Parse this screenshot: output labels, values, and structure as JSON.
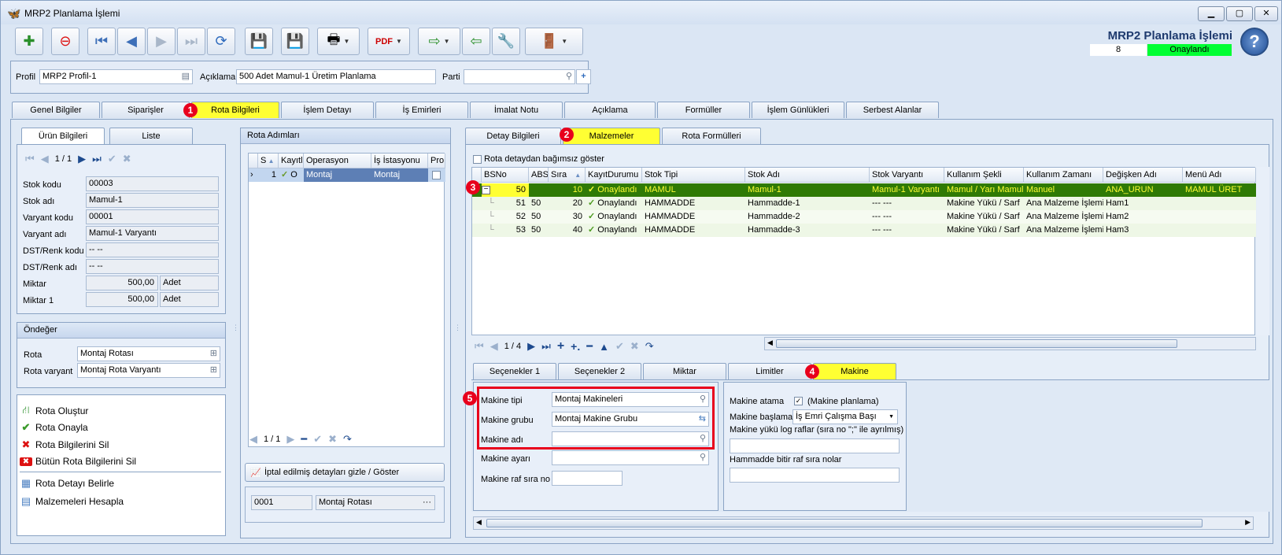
{
  "window": {
    "title": "MRP2 Planlama İşlemi",
    "header_title": "MRP2 Planlama İşlemi",
    "record_no": "8",
    "record_status": "Onaylandı"
  },
  "profile": {
    "profil_label": "Profil",
    "profil_value": "MRP2 Profil-1",
    "aciklama_label": "Açıklama",
    "aciklama_value": "500 Adet Mamul-1 Üretim Planlama",
    "parti_label": "Parti",
    "parti_value": ""
  },
  "main_tabs": [
    "Genel Bilgiler",
    "Siparişler",
    "Rota Bilgileri",
    "İşlem Detayı",
    "İş Emirleri",
    "İmalat Notu",
    "Açıklama",
    "Formüller",
    "İşlem Günlükleri",
    "Serbest Alanlar"
  ],
  "badges": [
    "1",
    "2",
    "3",
    "4",
    "5"
  ],
  "left": {
    "tabs": [
      "Ürün Bilgileri",
      "Liste"
    ],
    "nav_text": "1 / 1",
    "fields": [
      {
        "label": "Stok kodu",
        "value": "00003"
      },
      {
        "label": "Stok adı",
        "value": "Mamul-1"
      },
      {
        "label": "Varyant kodu",
        "value": "00001"
      },
      {
        "label": "Varyant adı",
        "value": "Mamul-1 Varyantı"
      },
      {
        "label": "DST/Renk kodu",
        "value": "-- --"
      },
      {
        "label": "DST/Renk adı",
        "value": "-- --"
      }
    ],
    "miktar_label": "Miktar",
    "miktar_value": "500,00",
    "miktar_unit": "Adet",
    "miktar1_label": "Miktar 1",
    "miktar1_value": "500,00",
    "miktar1_unit": "Adet",
    "ondeger_title": "Öndeğer",
    "rota_label": "Rota",
    "rota_value": "Montaj Rotası",
    "rota_varyant_label": "Rota varyant",
    "rota_varyant_value": "Montaj Rota Varyantı",
    "actions": [
      "Rota Oluştur",
      "Rota Onayla",
      "Rota Bilgilerini Sil",
      "Bütün Rota Bilgilerini Sil",
      "Rota Detayı Belirle",
      "Malzemeleri Hesapla"
    ]
  },
  "middle": {
    "title": "Rota Adımları",
    "headers": [
      "S",
      "Kayıtl",
      "Operasyon",
      "İş İstasyonu",
      "Pro"
    ],
    "row": [
      "1",
      "O",
      "Montaj",
      "Montaj",
      ""
    ],
    "nav_text": "1 / 1",
    "toggle_button": "İptal edilmiş detayları gizle / Göster",
    "bottom_code": "0001",
    "bottom_name": "Montaj Rotası",
    "bottom_dots": "···"
  },
  "right": {
    "tabs": [
      "Detay Bilgileri",
      "Malzemeler",
      "Rota Formülleri"
    ],
    "checkbox_label": "Rota detaydan bağımsız göster",
    "headers": [
      "BSNo",
      "ABS",
      "Sıra",
      "KayıtDurumu",
      "Stok Tipi",
      "Stok Adı",
      "Stok Varyantı",
      "Kullanım Şekli",
      "Kullanım Zamanı",
      "Değişken Adı",
      "Menü Adı"
    ],
    "rows": [
      [
        "50",
        "",
        "10",
        "Onaylandı",
        "MAMUL",
        "Mamul-1",
        "Mamul-1 Varyantı",
        "Mamul / Yarı Mamul",
        "Manuel",
        "ANA_URUN",
        "MAMUL ÜRET"
      ],
      [
        "51",
        "50",
        "20",
        "Onaylandı",
        "HAMMADDE",
        "Hammadde-1",
        "--- ---",
        "Makine Yükü / Sarf",
        "Ana Malzeme İşlemi",
        "Ham1",
        ""
      ],
      [
        "52",
        "50",
        "30",
        "Onaylandı",
        "HAMMADDE",
        "Hammadde-2",
        "--- ---",
        "Makine Yükü / Sarf",
        "Ana Malzeme İşlemi",
        "Ham2",
        ""
      ],
      [
        "53",
        "50",
        "40",
        "Onaylandı",
        "HAMMADDE",
        "Hammadde-3",
        "--- ---",
        "Makine Yükü / Sarf",
        "Ana Malzeme İşlemi",
        "Ham3",
        ""
      ]
    ],
    "nav_text": "1 / 4",
    "sub_tabs": [
      "Seçenekler 1",
      "Seçenekler 2",
      "Miktar",
      "Limitler",
      "Makine"
    ],
    "makine_tipi_label": "Makine tipi",
    "makine_tipi_value": "Montaj Makineleri",
    "makine_grubu_label": "Makine grubu",
    "makine_grubu_value": "Montaj Makine Grubu",
    "makine_adi_label": "Makine adı",
    "makine_adi_value": "",
    "makine_ayari_label": "Makine ayarı",
    "makine_ayari_value": "",
    "makine_raf_label": "Makine raf sıra no",
    "makine_raf_value": "",
    "makine_atama_label": "Makine atama",
    "makine_planlama_label": "(Makine planlama)",
    "makine_baslama_label": "Makine başlama",
    "makine_baslama_value": "İş Emri Çalışma Başı",
    "log_raflar_label": "Makine yükü log raflar (sıra no \";\" ile ayrılmış)",
    "hammadde_bitir_label": "Hammadde bitir raf sıra nolar"
  },
  "colors": {
    "highlight": "#ffff33",
    "selected_row": "#2f7a05",
    "badge": "#e8001c",
    "status": "#00ff33"
  }
}
